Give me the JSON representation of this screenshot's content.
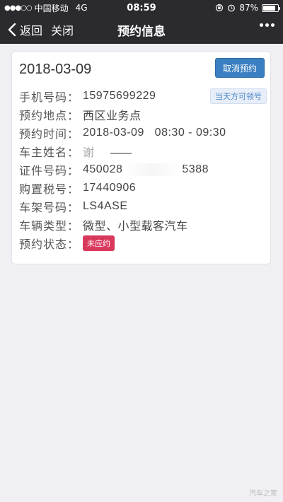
{
  "status_bar": {
    "carrier": "中国移动",
    "network": "4G",
    "time": "08:59",
    "battery_percent": "87%",
    "battery_level": 0.87
  },
  "nav": {
    "back_label": "返回",
    "close_label": "关闭",
    "title": "预约信息"
  },
  "appointment": {
    "date": "2018-03-09",
    "cancel_button": "取消预约",
    "same_day_tag": "当天方可领号",
    "rows": [
      {
        "label": "手机号码：",
        "value": "15975699229"
      },
      {
        "label": "预约地点：",
        "value": "西区业务点"
      },
      {
        "label": "预约时间：",
        "value": "2018-03-09   08:30 - 09:30"
      },
      {
        "label": "车主姓名：",
        "value": "谢"
      },
      {
        "label": "证件号码：",
        "value": "450028"
      },
      {
        "label": "购置税号：",
        "value": "17440906"
      },
      {
        "label": "车架号码：",
        "value": "LS4ASE"
      },
      {
        "label": "车辆类型：",
        "value": "微型、小型载客汽车"
      },
      {
        "label": "预约状态：",
        "value": "未应约"
      }
    ],
    "id_suffix": "5388"
  },
  "watermark": "汽车之家"
}
